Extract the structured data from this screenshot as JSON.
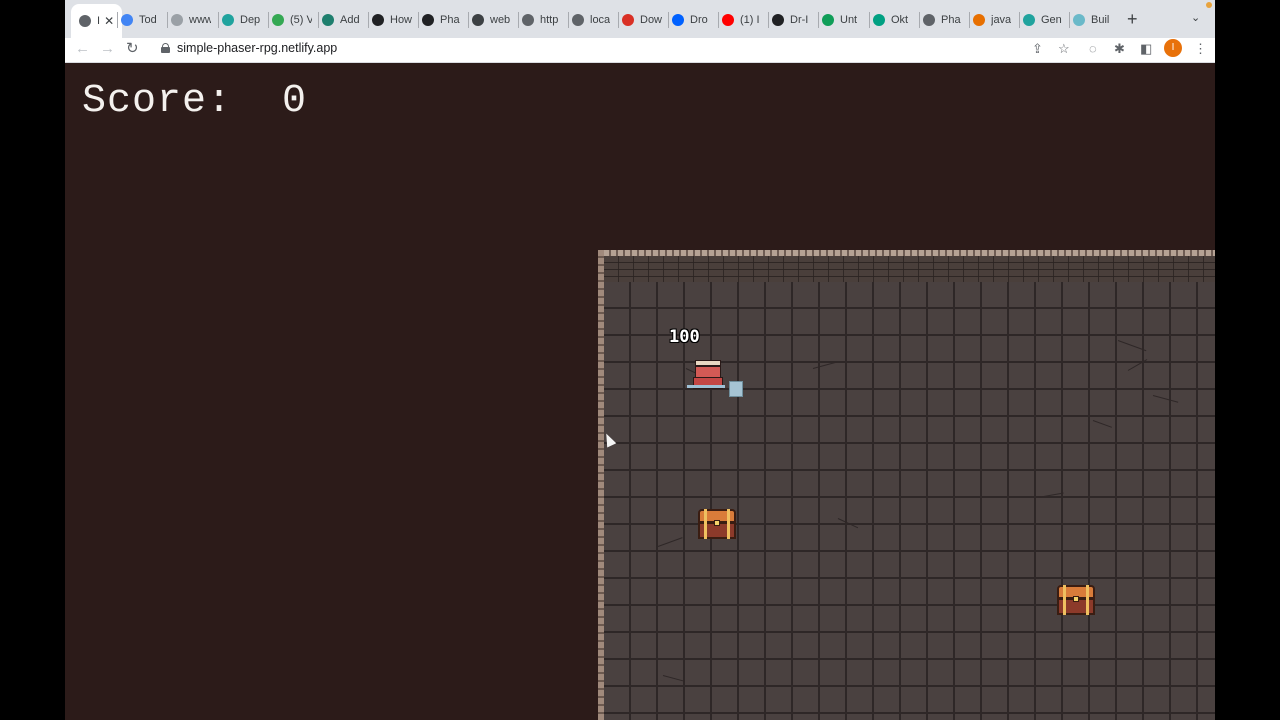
{
  "browser": {
    "tabs": [
      {
        "title": "I",
        "icon": "chrome-globe-icon",
        "color": "#5f6368",
        "active": true
      },
      {
        "title": "Tod",
        "icon": "google-docs-icon",
        "color": "#4285f4"
      },
      {
        "title": "www",
        "icon": "page-icon",
        "color": "#9aa0a6"
      },
      {
        "title": "Dep",
        "icon": "netlify-icon",
        "color": "#20a39e"
      },
      {
        "title": "(5) V",
        "icon": "green-badge-icon",
        "color": "#34a853"
      },
      {
        "title": "Add",
        "icon": "react-icon",
        "color": "#1e7f6e"
      },
      {
        "title": "How",
        "icon": "ceg-icon",
        "color": "#202124"
      },
      {
        "title": "Pha",
        "icon": "phaser-icon",
        "color": "#202124"
      },
      {
        "title": "web",
        "icon": "square-icon",
        "color": "#3c4043"
      },
      {
        "title": "http",
        "icon": "globe-icon",
        "color": "#5f6368"
      },
      {
        "title": "loca",
        "icon": "globe-icon",
        "color": "#5f6368"
      },
      {
        "title": "Dow",
        "icon": "store-icon",
        "color": "#d93025"
      },
      {
        "title": "Dro",
        "icon": "dropbox-icon",
        "color": "#0061ff"
      },
      {
        "title": "(1) I",
        "icon": "youtube-icon",
        "color": "#ff0000"
      },
      {
        "title": "Dr-I",
        "icon": "github-icon",
        "color": "#202124"
      },
      {
        "title": "Unt",
        "icon": "sheets-icon",
        "color": "#0f9d58"
      },
      {
        "title": "Okt",
        "icon": "okta-icon",
        "color": "#00a082"
      },
      {
        "title": "Pha",
        "icon": "globe-icon",
        "color": "#5f6368"
      },
      {
        "title": "java",
        "icon": "java-icon",
        "color": "#e76f00"
      },
      {
        "title": "Gen",
        "icon": "netlify-icon",
        "color": "#20a39e"
      },
      {
        "title": "Buil",
        "icon": "netlify-icon",
        "color": "#6ab9c9"
      }
    ],
    "new_tab": "+",
    "tab_list": "⌄",
    "url": "simple-phaser-rpg.netlify.app",
    "profile_initial": "I"
  },
  "game": {
    "score_label": "Score:",
    "score": 0,
    "score_text": "Score:  0",
    "player_health": "100",
    "chests": 2,
    "background_color": "#2c1b19"
  }
}
